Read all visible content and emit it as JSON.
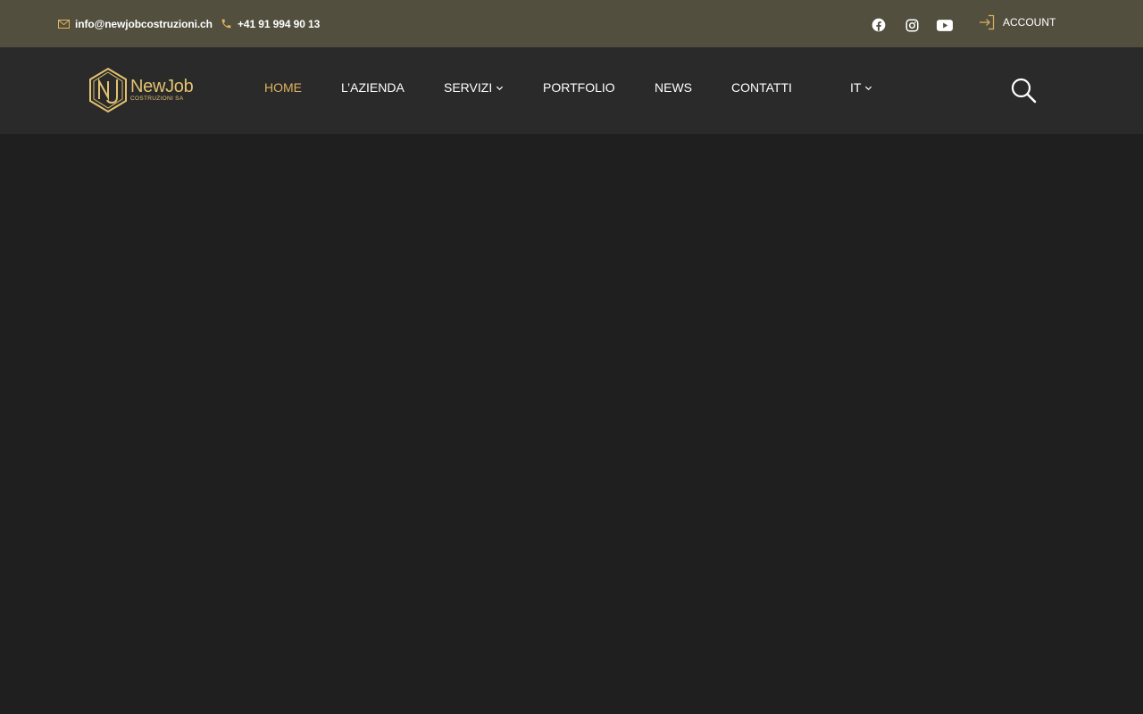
{
  "topbar": {
    "email": "info@newjobcostruzioni.ch",
    "phone": "+41 91 994 90 13",
    "social": [
      "facebook-icon",
      "instagram-icon",
      "youtube-icon"
    ],
    "account_label": "ACCOUNT"
  },
  "logo": {
    "brand": "NewJob",
    "sub": "COSTRUZIONI SA"
  },
  "nav": {
    "home": "HOME",
    "azienda": "L’AZIENDA",
    "servizi": "SERVIZI",
    "portfolio": "PORTFOLIO",
    "news": "NEWS",
    "contatti": "CONTATTI",
    "language": "IT"
  },
  "colors": {
    "topbar_bg": "#534f3f",
    "nav_bg": "#2a2a2a",
    "page_bg": "#1f1f1f",
    "accent": "#e0b35e",
    "logo_gold": "#e3c270"
  }
}
